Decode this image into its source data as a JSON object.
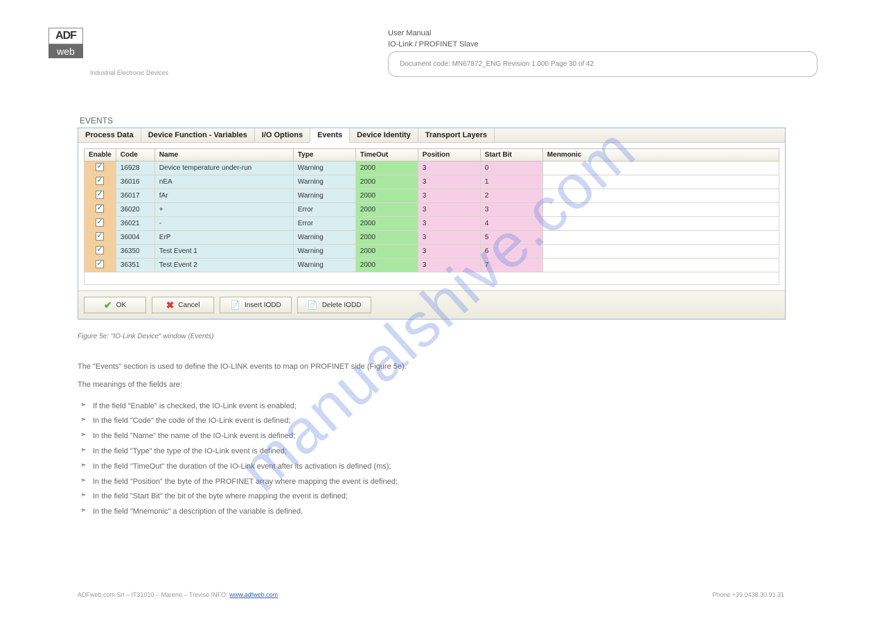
{
  "logo": {
    "top": "ADF",
    "bottom": "web"
  },
  "industrial": "Industrial Electronic Devices",
  "header": {
    "title": "User Manual",
    "subtitle": "IO-Link / PROFINET Slave",
    "doc": "Document code: MN67872_ENG Revision 1.000 Page 30 of 42"
  },
  "section_title": "EVENTS",
  "tabs": [
    "Process Data",
    "Device Function - Variables",
    "I/O Options",
    "Events",
    "Device Identity",
    "Transport Layers"
  ],
  "active_tab": 3,
  "columns": [
    "Enable",
    "Code",
    "Name",
    "Type",
    "TimeOut",
    "Position",
    "Start Bit",
    "Menmonic"
  ],
  "rows": [
    {
      "enable": true,
      "code": "16928",
      "name": "Device temperature under-run",
      "type": "Warning",
      "timeout": "2000",
      "position": "3",
      "startbit": "0",
      "mnemonic": ""
    },
    {
      "enable": true,
      "code": "36016",
      "name": "nEA",
      "type": "Warning",
      "timeout": "2000",
      "position": "3",
      "startbit": "1",
      "mnemonic": ""
    },
    {
      "enable": true,
      "code": "36017",
      "name": "fAr",
      "type": "Warning",
      "timeout": "2000",
      "position": "3",
      "startbit": "2",
      "mnemonic": ""
    },
    {
      "enable": true,
      "code": "36020",
      "name": "+",
      "type": "Error",
      "timeout": "2000",
      "position": "3",
      "startbit": "3",
      "mnemonic": ""
    },
    {
      "enable": true,
      "code": "36021",
      "name": "-",
      "type": "Error",
      "timeout": "2000",
      "position": "3",
      "startbit": "4",
      "mnemonic": ""
    },
    {
      "enable": true,
      "code": "36004",
      "name": "ErP",
      "type": "Warning",
      "timeout": "2000",
      "position": "3",
      "startbit": "5",
      "mnemonic": ""
    },
    {
      "enable": true,
      "code": "36350",
      "name": "Test Event 1",
      "type": "Warning",
      "timeout": "2000",
      "position": "3",
      "startbit": "6",
      "mnemonic": ""
    },
    {
      "enable": true,
      "code": "36351",
      "name": "Test Event 2",
      "type": "Warning",
      "timeout": "2000",
      "position": "3",
      "startbit": "7",
      "mnemonic": ""
    }
  ],
  "buttons": {
    "ok": "OK",
    "cancel": "Cancel",
    "insert": "Insert IODD",
    "delete": "Delete IODD"
  },
  "caption": "Figure 5e: \"IO-Link Device\" window (Events)",
  "description": {
    "intro": "The \"Events\" section is used to define the IO-LINK events to map on PROFINET side (Figure 5e).",
    "fields_intro": "The meanings of the fields are:",
    "items": [
      "If the field \"Enable\" is checked, the IO-Link event is enabled;",
      "In the field \"Code\" the code of the IO-Link event is defined;",
      "In the field \"Name\" the name of the IO-Link event is defined;",
      "In the field \"Type\" the type of the IO-Link event is defined;",
      "In the field \"TimeOut\" the duration of the IO-Link event after its activation is defined (ms);",
      "In the field \"Position\" the byte of the PROFINET array where mapping the event is defined;",
      "In the field \"Start Bit\" the bit of the byte where mapping the event is defined;",
      "In the field \"Mnemonic\" a description of the variable is defined."
    ]
  },
  "footer": {
    "left": "ADFweb.com Srl – IT31010 – Mareno – Treviso INFO:",
    "link": "www.adfweb.com",
    "right": "Phone +39.0438.30.91.31"
  },
  "watermark": "manualshive.com"
}
